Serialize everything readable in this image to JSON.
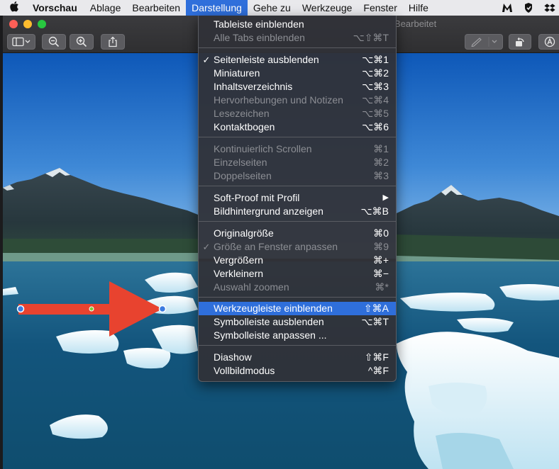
{
  "menubar": {
    "apple": "",
    "items": [
      "Vorschau",
      "Ablage",
      "Bearbeiten",
      "Darstellung",
      "Gehe zu",
      "Werkzeuge",
      "Fenster",
      "Hilfe"
    ],
    "active_index": 3
  },
  "window": {
    "title": "Bearbeitet"
  },
  "menu": {
    "g1": [
      {
        "label": "Tableiste einblenden",
        "shortcut": "",
        "check": "",
        "disabled": false
      },
      {
        "label": "Alle Tabs einblenden",
        "shortcut": "⌥⇧⌘T",
        "check": "",
        "disabled": true
      }
    ],
    "g2": [
      {
        "label": "Seitenleiste ausblenden",
        "shortcut": "⌥⌘1",
        "check": "✓",
        "disabled": false
      },
      {
        "label": "Miniaturen",
        "shortcut": "⌥⌘2",
        "check": "",
        "disabled": false
      },
      {
        "label": "Inhaltsverzeichnis",
        "shortcut": "⌥⌘3",
        "check": "",
        "disabled": false
      },
      {
        "label": "Hervorhebungen und Notizen",
        "shortcut": "⌥⌘4",
        "check": "",
        "disabled": true
      },
      {
        "label": "Lesezeichen",
        "shortcut": "⌥⌘5",
        "check": "",
        "disabled": true
      },
      {
        "label": "Kontaktbogen",
        "shortcut": "⌥⌘6",
        "check": "",
        "disabled": false
      }
    ],
    "g3": [
      {
        "label": "Kontinuierlich Scrollen",
        "shortcut": "⌘1",
        "check": "",
        "disabled": true
      },
      {
        "label": "Einzelseiten",
        "shortcut": "⌘2",
        "check": "",
        "disabled": true
      },
      {
        "label": "Doppelseiten",
        "shortcut": "⌘3",
        "check": "",
        "disabled": true
      }
    ],
    "g4": [
      {
        "label": "Soft-Proof mit Profil",
        "shortcut": "▶",
        "check": "",
        "disabled": false
      },
      {
        "label": "Bildhintergrund anzeigen",
        "shortcut": "⌥⌘B",
        "check": "",
        "disabled": false
      }
    ],
    "g5": [
      {
        "label": "Originalgröße",
        "shortcut": "⌘0",
        "check": "",
        "disabled": false
      },
      {
        "label": "Größe an Fenster anpassen",
        "shortcut": "⌘9",
        "check": "✓",
        "disabled": true
      },
      {
        "label": "Vergrößern",
        "shortcut": "⌘+",
        "check": "",
        "disabled": false
      },
      {
        "label": "Verkleinern",
        "shortcut": "⌘−",
        "check": "",
        "disabled": false
      },
      {
        "label": "Auswahl zoomen",
        "shortcut": "⌘*",
        "check": "",
        "disabled": true
      }
    ],
    "g6": [
      {
        "label": "Werkzeugleiste einblenden",
        "shortcut": "⇧⌘A",
        "check": "",
        "disabled": false,
        "highlighted": true
      },
      {
        "label": "Symbolleiste ausblenden",
        "shortcut": "⌥⌘T",
        "check": "",
        "disabled": false
      },
      {
        "label": "Symbolleiste anpassen ...",
        "shortcut": "",
        "check": "",
        "disabled": false
      }
    ],
    "g7": [
      {
        "label": "Diashow",
        "shortcut": "⇧⌘F",
        "check": "",
        "disabled": false
      },
      {
        "label": "Vollbildmodus",
        "shortcut": "^⌘F",
        "check": "",
        "disabled": false
      }
    ]
  },
  "icons": {
    "apple": "apple-logo-icon",
    "status": [
      "malwarebytes-icon",
      "keychain-icon",
      "dropbox-icon"
    ],
    "toolbar": [
      "sidebar-toggle-icon",
      "zoom-out-icon",
      "zoom-in-icon",
      "share-icon",
      "markup-pen-icon",
      "rotate-icon",
      "annotate-icon"
    ]
  },
  "colors": {
    "highlight": "#2f6fdb",
    "arrow": "#e8432f"
  }
}
